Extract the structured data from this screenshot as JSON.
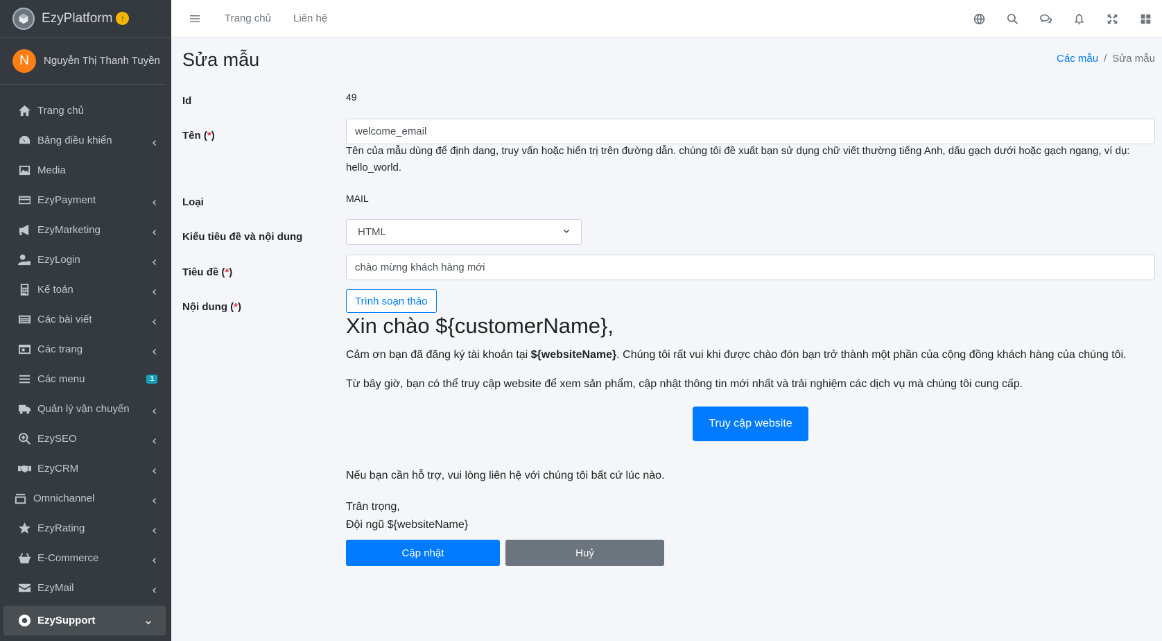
{
  "brand": {
    "name": "EzyPlatform",
    "badge_icon": "arrow-up-circle-icon"
  },
  "user": {
    "initial": "N",
    "name": "Nguyễn Thị Thanh Tuyền",
    "avatar_color": "#fd7e14"
  },
  "sidebar": {
    "items": [
      {
        "label": "Trang chủ",
        "icon": "home-icon"
      },
      {
        "label": "Bảng điều khiển",
        "icon": "dashboard-icon"
      },
      {
        "label": "Media",
        "icon": "image-icon"
      },
      {
        "label": "EzyPayment",
        "icon": "credit-card-icon"
      },
      {
        "label": "EzyMarketing",
        "icon": "megaphone-icon"
      },
      {
        "label": "EzyLogin",
        "icon": "user-lock-icon"
      },
      {
        "label": "Kế toán",
        "icon": "calculator-icon"
      },
      {
        "label": "Các bài viết",
        "icon": "newspaper-icon"
      },
      {
        "label": "Các trang",
        "icon": "window-icon"
      },
      {
        "label": "Các menu",
        "icon": "bars-icon",
        "badge": "1"
      },
      {
        "label": "Quản lý vận chuyển",
        "icon": "truck-icon"
      },
      {
        "label": "EzySEO",
        "icon": "search-plus-icon"
      },
      {
        "label": "EzyCRM",
        "icon": "handshake-icon"
      },
      {
        "label": "Omnichannel",
        "icon": "inbox-icon"
      },
      {
        "label": "EzyRating",
        "icon": "star-icon"
      },
      {
        "label": "E-Commerce",
        "icon": "basket-icon"
      },
      {
        "label": "EzyMail",
        "icon": "envelope-icon"
      },
      {
        "label": "EzySupport",
        "icon": "life-ring-icon"
      }
    ]
  },
  "navbar": {
    "links": [
      "Trang chủ",
      "Liên hệ"
    ],
    "icons": [
      "globe-icon",
      "search-icon",
      "comments-icon",
      "bell-icon",
      "expand-icon",
      "grid-icon"
    ]
  },
  "page": {
    "title": "Sửa mẫu",
    "breadcrumb": {
      "parent": "Các mẫu",
      "current": "Sửa mẫu"
    }
  },
  "form": {
    "id_label": "Id",
    "id_value": "49",
    "name_label": "Tên (",
    "required_mark": "*",
    "close_paren": ")",
    "name_value": "welcome_email",
    "name_help": "Tên của mẫu dùng để định dang, truy vấn hoặc hiển trị trên đường dẫn. chúng tôi đề xuất bạn sử dụng chữ viết thường tiếng Anh, dấu gạch dưới hoặc gạch ngang, ví dụ: hello_world.",
    "type_label": "Loại",
    "type_value": "MAIL",
    "content_type_label": "Kiểu tiêu đề và nội dung",
    "content_type_value": "HTML",
    "subject_label": "Tiêu đề (",
    "subject_value": "chào mừng khách hàng mới",
    "content_label": "Nội dung (",
    "editor_button": "Trình soạn thảo",
    "update_button": "Cập nhật",
    "cancel_button": "Huỷ"
  },
  "email": {
    "heading": "Xin chào ${customerName},",
    "p1_before": "Cảm ơn bạn đã đăng ký tài khoản tại ",
    "p1_bold": "${websiteName}",
    "p1_after": ". Chúng tôi rất vui khi được chào đón bạn trở thành một phần của cộng đồng khách hàng của chúng tôi.",
    "p2": "Từ bây giờ, bạn có thể truy cập website để xem sản phẩm, cập nhật thông tin mới nhất và trải nghiệm các dịch vụ mà chúng tôi cung cấp.",
    "cta": "Truy cập website",
    "p3": "Nếu bạn cần hỗ trợ, vui lòng liên hệ với chúng tôi bất cứ lúc nào.",
    "sign1": "Trân trọng,",
    "sign2": "Đội ngũ ${websiteName}"
  }
}
